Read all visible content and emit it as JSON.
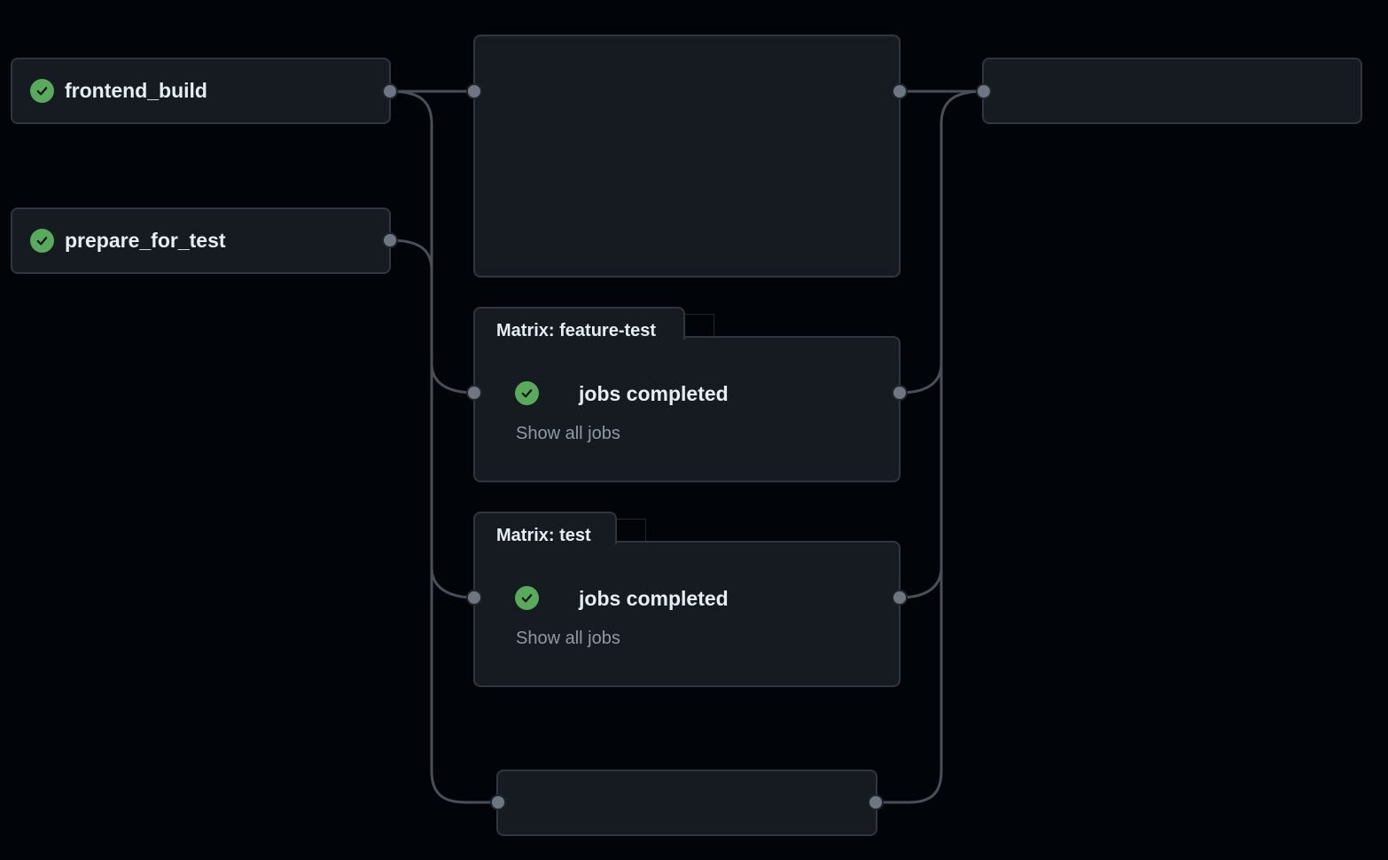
{
  "jobs": [
    {
      "name": "frontend_build",
      "status": "success"
    },
    {
      "name": "prepare_for_test",
      "status": "success"
    }
  ],
  "matrices": [
    {
      "label": "Matrix: feature-test",
      "title": "jobs completed",
      "link": "Show all jobs",
      "status": "success"
    },
    {
      "label": "Matrix: test",
      "title": "jobs completed",
      "link": "Show all jobs",
      "status": "success"
    }
  ],
  "icons": {
    "status": "check-circle-icon",
    "port": "connector-dot"
  },
  "colors": {
    "background": "#010409",
    "card": "#161b22",
    "border": "#30363d",
    "success": "#57ab5a",
    "text": "#e6edf3",
    "muted": "#9198a1",
    "connector": "#484f58"
  }
}
